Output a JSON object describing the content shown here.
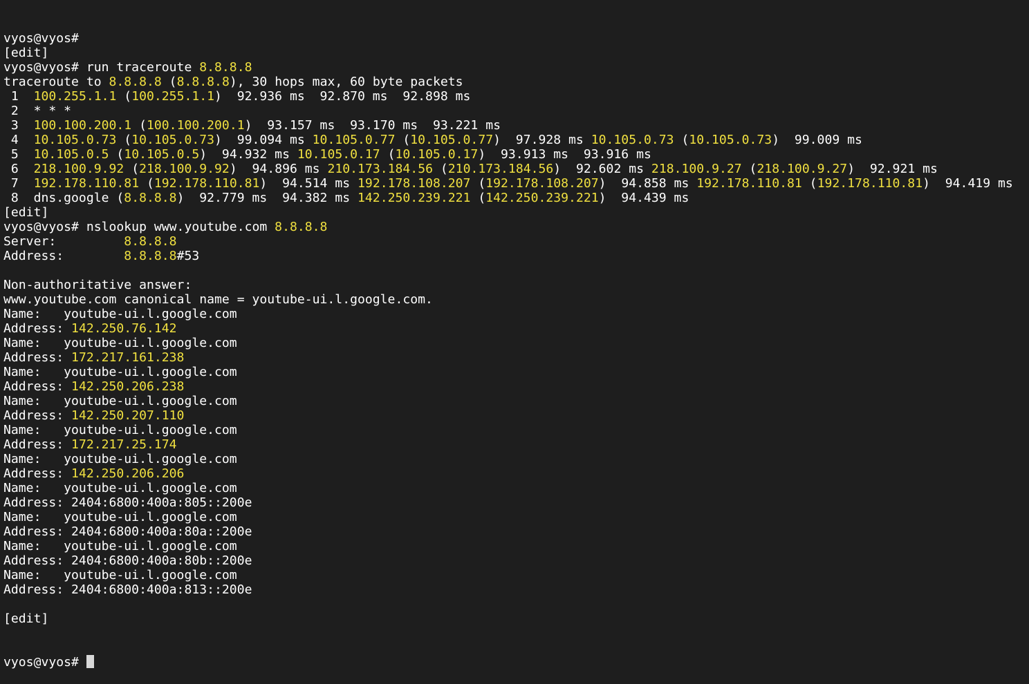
{
  "terminal": {
    "colors": {
      "background": "#1e1e1e",
      "text": "#ffffff",
      "highlight": "#f0e040",
      "cursor": "#d8d8d8"
    },
    "lines": [
      [
        [
          "vyos@vyos#",
          "w"
        ]
      ],
      [
        [
          "[edit]",
          "w"
        ]
      ],
      [
        [
          "vyos@vyos# run traceroute ",
          "w"
        ],
        [
          "8.8.8.8",
          "y"
        ]
      ],
      [
        [
          "traceroute to ",
          "w"
        ],
        [
          "8.8.8.8",
          "y"
        ],
        [
          " (",
          "w"
        ],
        [
          "8.8.8.8",
          "y"
        ],
        [
          "), 30 hops max, 60 byte packets",
          "w"
        ]
      ],
      [
        [
          " 1  ",
          "w"
        ],
        [
          "100.255.1.1",
          "y"
        ],
        [
          " (",
          "w"
        ],
        [
          "100.255.1.1",
          "y"
        ],
        [
          ")  92.936 ms  92.870 ms  92.898 ms",
          "w"
        ]
      ],
      [
        [
          " 2  * * *",
          "w"
        ]
      ],
      [
        [
          " 3  ",
          "w"
        ],
        [
          "100.100.200.1",
          "y"
        ],
        [
          " (",
          "w"
        ],
        [
          "100.100.200.1",
          "y"
        ],
        [
          ")  93.157 ms  93.170 ms  93.221 ms",
          "w"
        ]
      ],
      [
        [
          " 4  ",
          "w"
        ],
        [
          "10.105.0.73",
          "y"
        ],
        [
          " (",
          "w"
        ],
        [
          "10.105.0.73",
          "y"
        ],
        [
          ")  99.094 ms ",
          "w"
        ],
        [
          "10.105.0.77",
          "y"
        ],
        [
          " (",
          "w"
        ],
        [
          "10.105.0.77",
          "y"
        ],
        [
          ")  97.928 ms ",
          "w"
        ],
        [
          "10.105.0.73",
          "y"
        ],
        [
          " (",
          "w"
        ],
        [
          "10.105.0.73",
          "y"
        ],
        [
          ")  99.009 ms",
          "w"
        ]
      ],
      [
        [
          " 5  ",
          "w"
        ],
        [
          "10.105.0.5",
          "y"
        ],
        [
          " (",
          "w"
        ],
        [
          "10.105.0.5",
          "y"
        ],
        [
          ")  94.932 ms ",
          "w"
        ],
        [
          "10.105.0.17",
          "y"
        ],
        [
          " (",
          "w"
        ],
        [
          "10.105.0.17",
          "y"
        ],
        [
          ")  93.913 ms  93.916 ms",
          "w"
        ]
      ],
      [
        [
          " 6  ",
          "w"
        ],
        [
          "218.100.9.92",
          "y"
        ],
        [
          " (",
          "w"
        ],
        [
          "218.100.9.92",
          "y"
        ],
        [
          ")  94.896 ms ",
          "w"
        ],
        [
          "210.173.184.56",
          "y"
        ],
        [
          " (",
          "w"
        ],
        [
          "210.173.184.56",
          "y"
        ],
        [
          ")  92.602 ms ",
          "w"
        ],
        [
          "218.100.9.27",
          "y"
        ],
        [
          " (",
          "w"
        ],
        [
          "218.100.9.27",
          "y"
        ],
        [
          ")  92.921 ms",
          "w"
        ]
      ],
      [
        [
          " 7  ",
          "w"
        ],
        [
          "192.178.110.81",
          "y"
        ],
        [
          " (",
          "w"
        ],
        [
          "192.178.110.81",
          "y"
        ],
        [
          ")  94.514 ms ",
          "w"
        ],
        [
          "192.178.108.207",
          "y"
        ],
        [
          " (",
          "w"
        ],
        [
          "192.178.108.207",
          "y"
        ],
        [
          ")  94.858 ms ",
          "w"
        ],
        [
          "192.178.110.81",
          "y"
        ],
        [
          " (",
          "w"
        ],
        [
          "192.178.110.81",
          "y"
        ],
        [
          ")  94.419 ms",
          "w"
        ]
      ],
      [
        [
          " 8  dns.google (",
          "w"
        ],
        [
          "8.8.8.8",
          "y"
        ],
        [
          ")  92.779 ms  94.382 ms ",
          "w"
        ],
        [
          "142.250.239.221",
          "y"
        ],
        [
          " (",
          "w"
        ],
        [
          "142.250.239.221",
          "y"
        ],
        [
          ")  94.439 ms",
          "w"
        ]
      ],
      [
        [
          "[edit]",
          "w"
        ]
      ],
      [
        [
          "vyos@vyos# nslookup www.youtube.com ",
          "w"
        ],
        [
          "8.8.8.8",
          "y"
        ]
      ],
      [
        [
          "Server:         ",
          "w"
        ],
        [
          "8.8.8.8",
          "y"
        ]
      ],
      [
        [
          "Address:        ",
          "w"
        ],
        [
          "8.8.8.8",
          "y"
        ],
        [
          "#53",
          "w"
        ]
      ],
      [],
      [
        [
          "Non-authoritative answer:",
          "w"
        ]
      ],
      [
        [
          "www.youtube.com canonical name = youtube-ui.l.google.com.",
          "w"
        ]
      ],
      [
        [
          "Name:   youtube-ui.l.google.com",
          "w"
        ]
      ],
      [
        [
          "Address: ",
          "w"
        ],
        [
          "142.250.76.142",
          "y"
        ]
      ],
      [
        [
          "Name:   youtube-ui.l.google.com",
          "w"
        ]
      ],
      [
        [
          "Address: ",
          "w"
        ],
        [
          "172.217.161.238",
          "y"
        ]
      ],
      [
        [
          "Name:   youtube-ui.l.google.com",
          "w"
        ]
      ],
      [
        [
          "Address: ",
          "w"
        ],
        [
          "142.250.206.238",
          "y"
        ]
      ],
      [
        [
          "Name:   youtube-ui.l.google.com",
          "w"
        ]
      ],
      [
        [
          "Address: ",
          "w"
        ],
        [
          "142.250.207.110",
          "y"
        ]
      ],
      [
        [
          "Name:   youtube-ui.l.google.com",
          "w"
        ]
      ],
      [
        [
          "Address: ",
          "w"
        ],
        [
          "172.217.25.174",
          "y"
        ]
      ],
      [
        [
          "Name:   youtube-ui.l.google.com",
          "w"
        ]
      ],
      [
        [
          "Address: ",
          "w"
        ],
        [
          "142.250.206.206",
          "y"
        ]
      ],
      [
        [
          "Name:   youtube-ui.l.google.com",
          "w"
        ]
      ],
      [
        [
          "Address: 2404:6800:400a:805::200e",
          "w"
        ]
      ],
      [
        [
          "Name:   youtube-ui.l.google.com",
          "w"
        ]
      ],
      [
        [
          "Address: 2404:6800:400a:80a::200e",
          "w"
        ]
      ],
      [
        [
          "Name:   youtube-ui.l.google.com",
          "w"
        ]
      ],
      [
        [
          "Address: 2404:6800:400a:80b::200e",
          "w"
        ]
      ],
      [
        [
          "Name:   youtube-ui.l.google.com",
          "w"
        ]
      ],
      [
        [
          "Address: 2404:6800:400a:813::200e",
          "w"
        ]
      ],
      [],
      [
        [
          "[edit]",
          "w"
        ]
      ]
    ],
    "prompt": "vyos@vyos# "
  }
}
